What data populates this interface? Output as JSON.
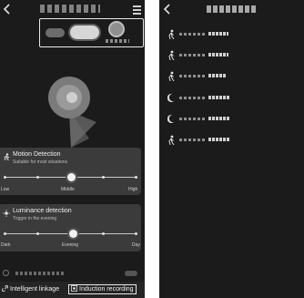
{
  "motion": {
    "title": "Motion Detection",
    "subtitle": "Suitable for most situations",
    "levels": [
      "Low",
      "Middle",
      "High"
    ],
    "selected": "Middle"
  },
  "luminance": {
    "title": "Luminance detection",
    "subtitle": "Trigger in the evening",
    "levels": [
      "Dark",
      "Evening",
      "Day"
    ],
    "selected": "Evening"
  },
  "bottom_bar": {
    "intelligent_linkage": "Intelligent linkage",
    "induction_recording": "Induction recording"
  },
  "colors": {
    "background": "#1b1b1b",
    "card": "#3b3b3b",
    "highlight_border": "#e8e8e8"
  },
  "icons": [
    "back-arrow-icon",
    "menu-icon",
    "motion-icon",
    "sun-icon",
    "link-icon",
    "record-icon"
  ]
}
